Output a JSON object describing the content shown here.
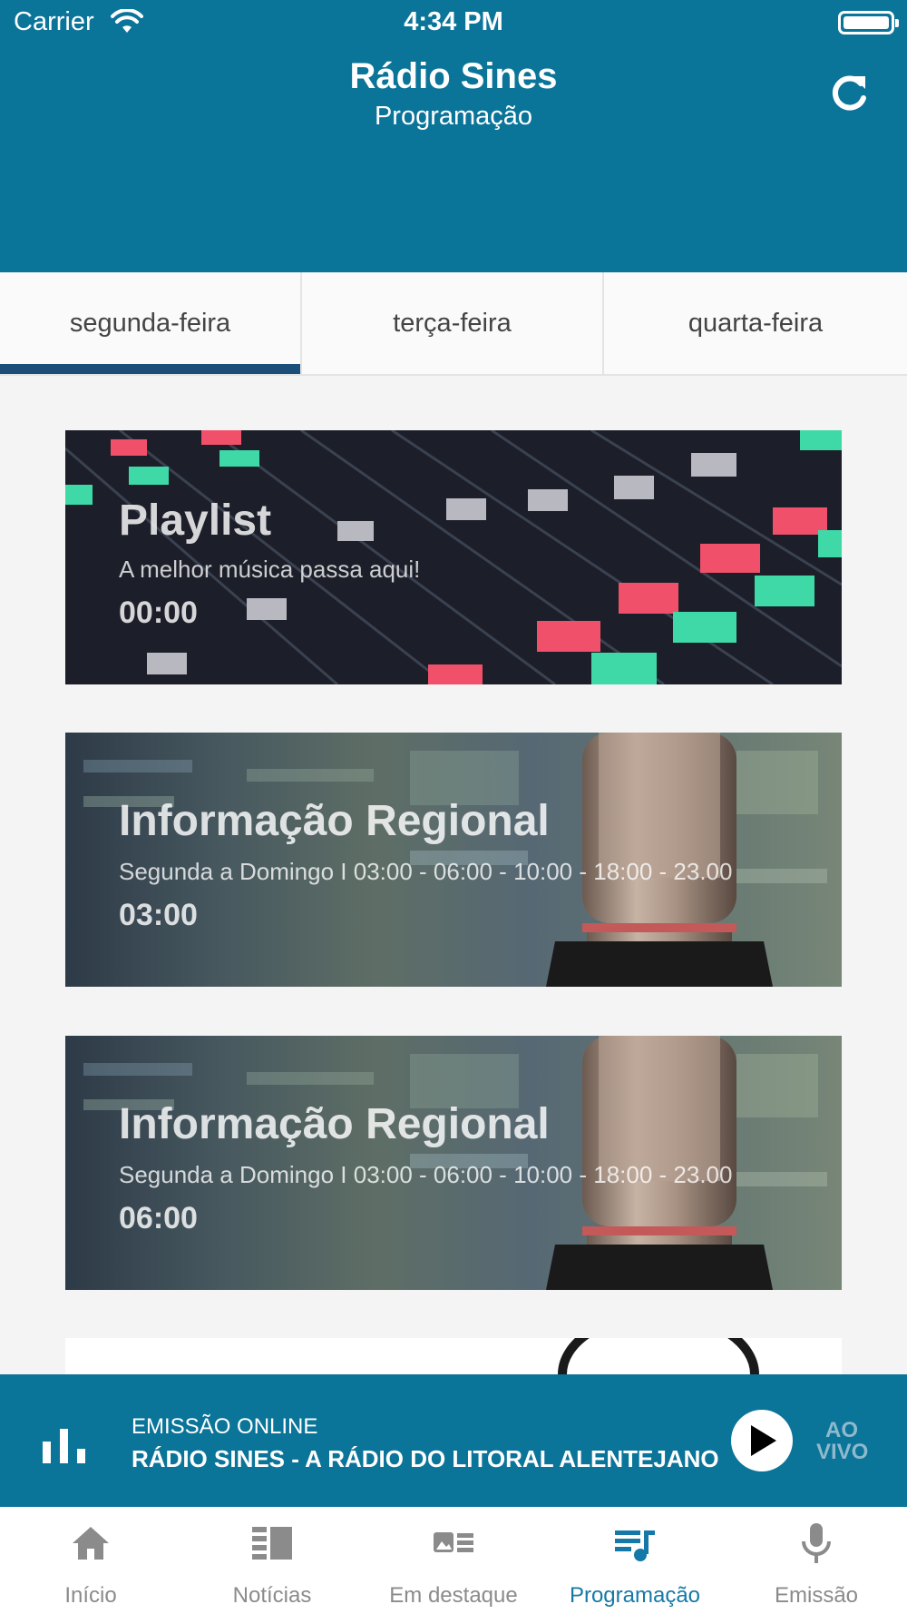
{
  "status_bar": {
    "carrier": "Carrier",
    "time": "4:34 PM"
  },
  "header": {
    "title": "Rádio Sines",
    "subtitle": "Programação"
  },
  "tabs": [
    {
      "label": "segunda-feira",
      "active": true
    },
    {
      "label": "terça-feira",
      "active": false
    },
    {
      "label": "quarta-feira",
      "active": false
    }
  ],
  "programs": [
    {
      "title": "Playlist",
      "description": "A melhor música passa aqui!",
      "time": "00:00",
      "image": "mixer-console"
    },
    {
      "title": "Informação Regional",
      "description": "Segunda a Domingo I 03:00 - 06:00 - 10:00 - 18:00 - 23.00",
      "time": "03:00",
      "image": "studio-microphone"
    },
    {
      "title": "Informação Regional",
      "description": "Segunda a Domingo I 03:00 - 06:00 - 10:00 - 18:00 - 23.00",
      "time": "06:00",
      "image": "studio-microphone"
    }
  ],
  "player": {
    "label": "EMISSÃO ONLINE",
    "station": "RÁDIO SINES - A RÁDIO DO LITORAL ALENTEJANO",
    "live_line1": "AO",
    "live_line2": "VIVO"
  },
  "bottom_nav": [
    {
      "label": "Início",
      "icon": "home-icon",
      "active": false
    },
    {
      "label": "Notícias",
      "icon": "news-icon",
      "active": false
    },
    {
      "label": "Em destaque",
      "icon": "featured-icon",
      "active": false
    },
    {
      "label": "Programação",
      "icon": "schedule-icon",
      "active": true
    },
    {
      "label": "Emissão",
      "icon": "microphone-icon",
      "active": false
    }
  ],
  "colors": {
    "primary": "#0b7499",
    "tab_indicator": "#1c4e7a",
    "nav_active": "#1479a8",
    "nav_inactive": "#8b8b8b"
  }
}
